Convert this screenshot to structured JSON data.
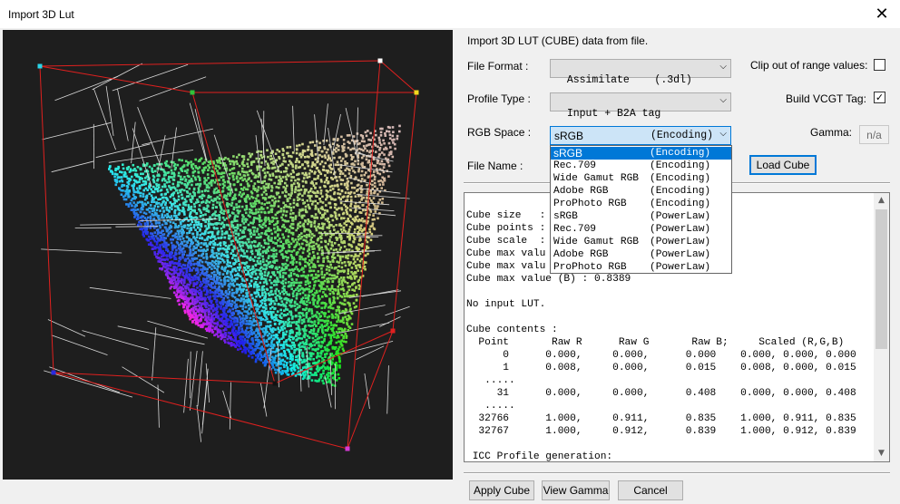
{
  "window": {
    "title": "Import 3D Lut",
    "close_icon": "close-icon"
  },
  "description": "Import 3D LUT (CUBE) data from file.",
  "fields": {
    "file_format_label": "File Format :",
    "file_format_value": "Assimilate    (.3dl)",
    "profile_type_label": "Profile Type :",
    "profile_type_value": "Input + B2A tag",
    "rgb_space_label": "RGB Space :",
    "rgb_space_value": "sRGB",
    "rgb_space_encoding": "(Encoding)",
    "file_name_label": "File Name :"
  },
  "options": {
    "clip_label": "Clip out of range values:",
    "clip_checked": false,
    "vcgt_label": "Build VCGT Tag:",
    "vcgt_checked": true,
    "vcgt_mark": "✓",
    "gamma_label": "Gamma:",
    "gamma_value": "n/a"
  },
  "buttons": {
    "load_cube": "Load Cube",
    "apply_cube": "Apply Cube",
    "view_gamma": "View Gamma",
    "cancel": "Cancel"
  },
  "rgb_space_options": [
    {
      "name": "sRGB",
      "encoding": "(Encoding)"
    },
    {
      "name": "Rec.709",
      "encoding": "(Encoding)"
    },
    {
      "name": "Wide Gamut RGB",
      "encoding": "(Encoding)"
    },
    {
      "name": "Adobe RGB",
      "encoding": "(Encoding)"
    },
    {
      "name": "ProPhoto RGB",
      "encoding": "(Encoding)"
    },
    {
      "name": "sRGB",
      "encoding": "(PowerLaw)"
    },
    {
      "name": "Rec.709",
      "encoding": "(PowerLaw)"
    },
    {
      "name": "Wide Gamut RGB",
      "encoding": "(PowerLaw)"
    },
    {
      "name": "Adobe RGB",
      "encoding": "(PowerLaw)"
    },
    {
      "name": "ProPhoto RGB",
      "encoding": "(PowerLaw)"
    }
  ],
  "info_text": "\nCube size   :\nCube points :\nCube scale  :\nCube max valu\nCube max valu\nCube max value (B) : 0.8389\n\nNo input LUT.\n\nCube contents :\n  Point       Raw R      Raw G       Raw B;     Scaled (R,G,B)\n      0      0.000,     0.000,      0.000    0.000, 0.000, 0.000\n      1      0.008,     0.000,      0.015    0.008, 0.000, 0.015\n   .....\n     31      0.000,     0.000,      0.408    0.000, 0.000, 0.408\n   .....\n  32766      1.000,     0.911,      0.835    1.000, 0.911, 0.835\n  32767      1.000,     0.912,      0.839    1.000, 0.912, 0.839\n\n ICC Profile generation:",
  "scrollbar": {
    "up_icon": "▲",
    "down_icon": "▼"
  }
}
